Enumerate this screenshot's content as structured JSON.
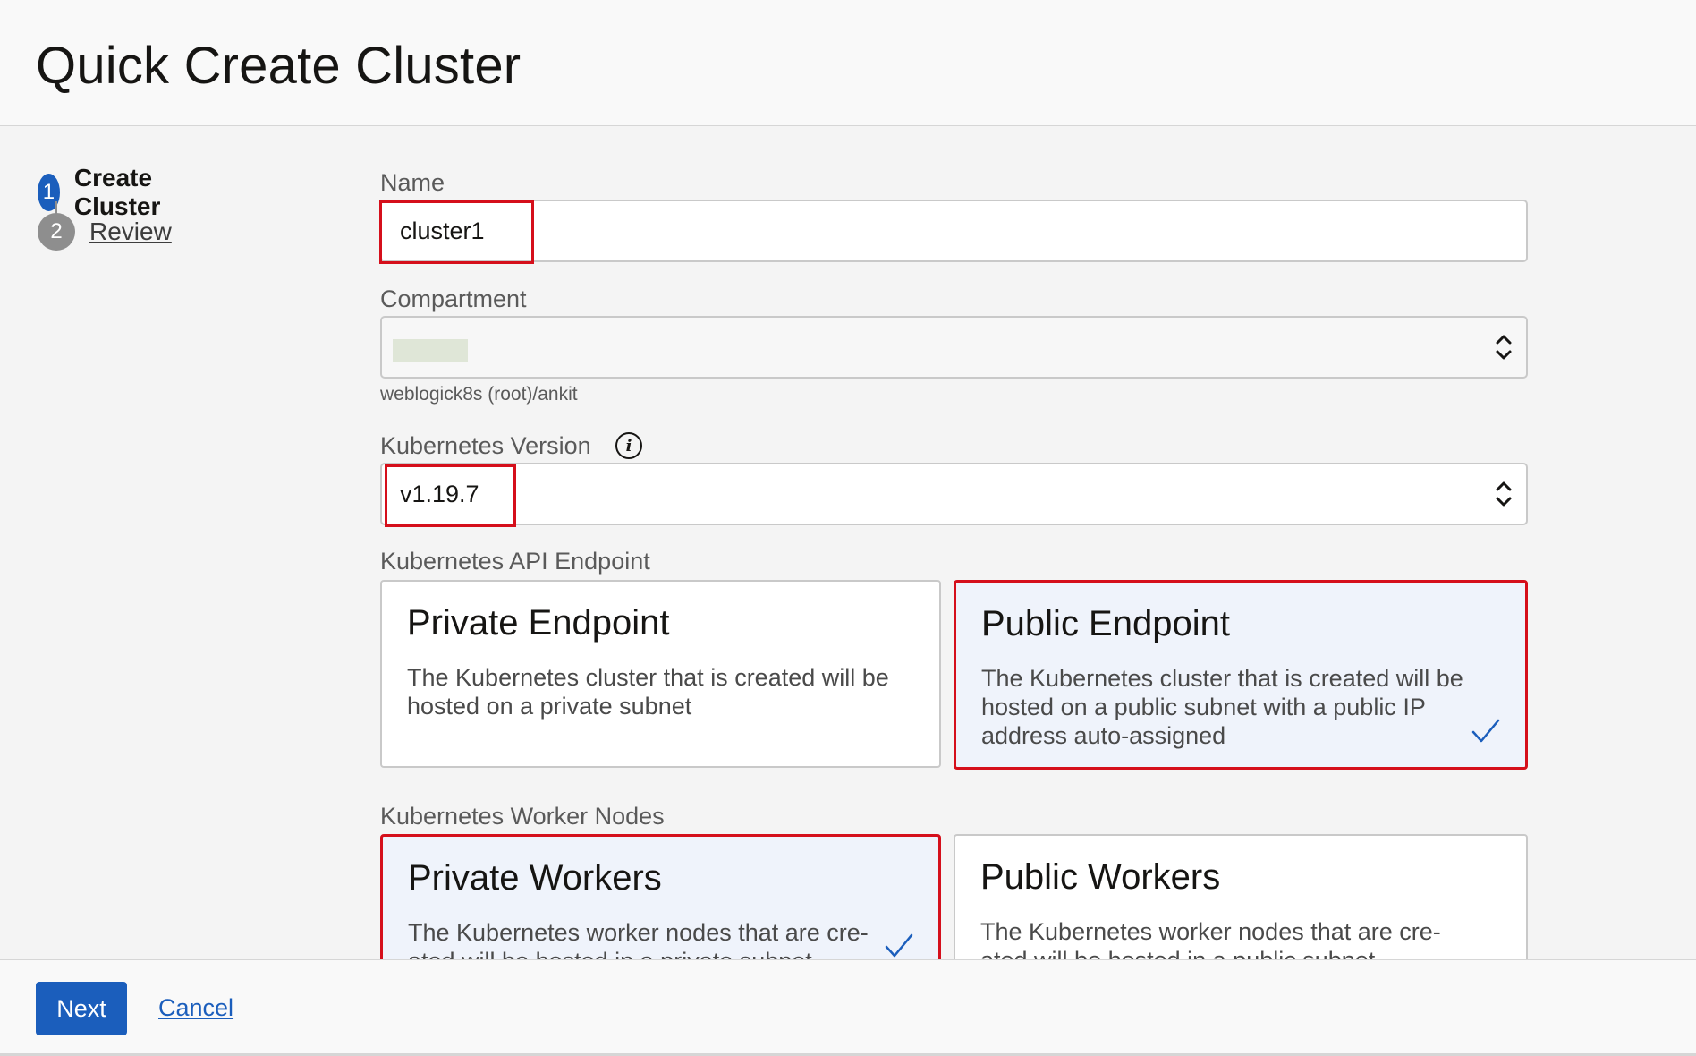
{
  "header": {
    "title": "Quick Create Cluster"
  },
  "stepper": {
    "steps": [
      {
        "number": "1",
        "label": "Create Cluster"
      },
      {
        "number": "2",
        "label": "Review"
      }
    ]
  },
  "form": {
    "name": {
      "label": "Name",
      "value": "cluster1"
    },
    "compartment": {
      "label": "Compartment",
      "helper": "weblogick8s (root)/ankit"
    },
    "kubernetes_version": {
      "label": "Kubernetes Version",
      "value": "v1.19.7"
    },
    "api_endpoint": {
      "label": "Kubernetes API Endpoint",
      "options": [
        {
          "title": "Private Endpoint",
          "description": "The Kubernetes cluster that is created will be hosted on a private subnet"
        },
        {
          "title": "Public Endpoint",
          "description": "The Kubernetes cluster that is created will be hosted on a public subnet with a public IP address auto-assigned"
        }
      ]
    },
    "worker_nodes": {
      "label": "Kubernetes Worker Nodes",
      "options": [
        {
          "title": "Private Workers",
          "description": "The Kubernetes worker nodes that are cre- ated will be hosted in a private subnet"
        },
        {
          "title": "Public Workers",
          "description": "The Kubernetes worker nodes that are cre- ated will be hosted in a public subnet"
        }
      ]
    }
  },
  "footer": {
    "next_label": "Next",
    "cancel_label": "Cancel"
  },
  "colors": {
    "accent": "#1b5ebc",
    "highlight": "#d50f1b"
  }
}
